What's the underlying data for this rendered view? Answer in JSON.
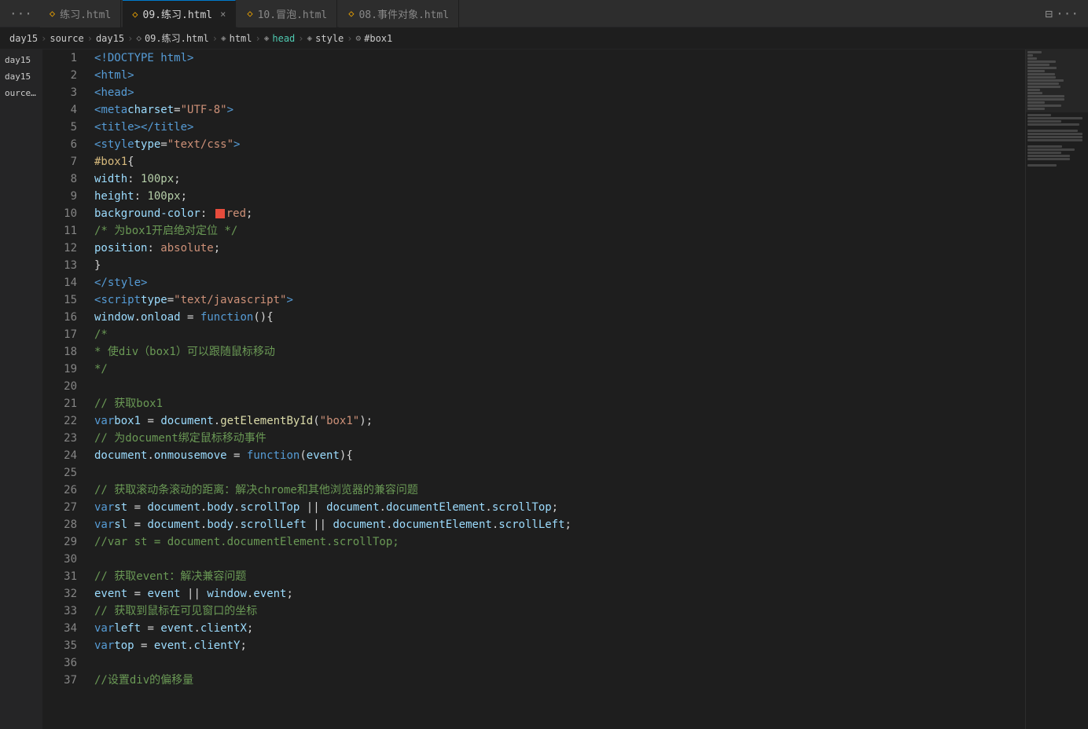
{
  "tabBar": {
    "dotsLeft": "···",
    "tabs": [
      {
        "id": "tab1",
        "icon": "◇",
        "label": "练习.html",
        "active": false,
        "closable": false
      },
      {
        "id": "tab2",
        "icon": "◇",
        "label": "09.练习.html",
        "active": true,
        "closable": true
      },
      {
        "id": "tab3",
        "icon": "◇",
        "label": "10.冒泡.html",
        "active": false,
        "closable": false
      },
      {
        "id": "tab4",
        "icon": "◇",
        "label": "08.事件对象.html",
        "active": false,
        "closable": false
      }
    ],
    "dotsRight": "···",
    "layoutIcon": "⊟"
  },
  "breadcrumb": {
    "items": [
      "day15",
      ">",
      "source",
      ">",
      "day15",
      ">",
      "09.练习.html",
      ">",
      "html",
      ">",
      "head",
      ">",
      "style",
      ">",
      "#box1"
    ]
  },
  "sidebar": {
    "items": [
      "day15",
      "day15",
      "ource\\..."
    ]
  },
  "lines": [
    {
      "num": 1,
      "content": "<!DOCTYPE html>"
    },
    {
      "num": 2,
      "content": "<html>"
    },
    {
      "num": 3,
      "content": "    <head>"
    },
    {
      "num": 4,
      "content": "        <meta charset=\"UTF-8\">"
    },
    {
      "num": 5,
      "content": "        <title></title>"
    },
    {
      "num": 6,
      "content": "        <style type=\"text/css\">"
    },
    {
      "num": 7,
      "content": "            #box1{"
    },
    {
      "num": 8,
      "content": "                width: 100px;"
    },
    {
      "num": 9,
      "content": "                height: 100px;"
    },
    {
      "num": 10,
      "content": "                background-color: red;",
      "hasColorBox": true
    },
    {
      "num": 11,
      "content": "                /* 为box1开启绝对定位 */"
    },
    {
      "num": 12,
      "content": "                position: absolute;"
    },
    {
      "num": 13,
      "content": "            }"
    },
    {
      "num": 14,
      "content": "        </style>"
    },
    {
      "num": 15,
      "content": "        <script type=\"text/javascript\">"
    },
    {
      "num": 16,
      "content": "            window.onload = function(){"
    },
    {
      "num": 17,
      "content": "                /*"
    },
    {
      "num": 18,
      "content": "                * 使div（box1）可以跟随鼠标移动"
    },
    {
      "num": 19,
      "content": "                */"
    },
    {
      "num": 20,
      "content": ""
    },
    {
      "num": 21,
      "content": "                // 获取box1"
    },
    {
      "num": 22,
      "content": "                var box1 = document.getElementById(\"box1\");"
    },
    {
      "num": 23,
      "content": "                // 为document绑定鼠标移动事件"
    },
    {
      "num": 24,
      "content": "                document.onmousemove = function(event){"
    },
    {
      "num": 25,
      "content": ""
    },
    {
      "num": 26,
      "content": "                    // 获取滚动条滚动的距离：解决chrome和其他浏览器的兼容问题"
    },
    {
      "num": 27,
      "content": "                    var st = document.body.scrollTop || document.documentElement.scrollTop;"
    },
    {
      "num": 28,
      "content": "                    var sl = document.body.scrollLeft || document.documentElement.scrollLeft;"
    },
    {
      "num": 29,
      "content": "                    //var st = document.documentElement.scrollTop;"
    },
    {
      "num": 30,
      "content": ""
    },
    {
      "num": 31,
      "content": "                    // 获取event：解决兼容问题"
    },
    {
      "num": 32,
      "content": "                    event = event || window.event;"
    },
    {
      "num": 33,
      "content": "                    // 获取到鼠标在可见窗口的坐标"
    },
    {
      "num": 34,
      "content": "                    var left = event.clientX;"
    },
    {
      "num": 35,
      "content": "                    var  top = event.clientY;"
    },
    {
      "num": 36,
      "content": ""
    },
    {
      "num": 37,
      "content": "                    //设置div的偏移量"
    }
  ]
}
